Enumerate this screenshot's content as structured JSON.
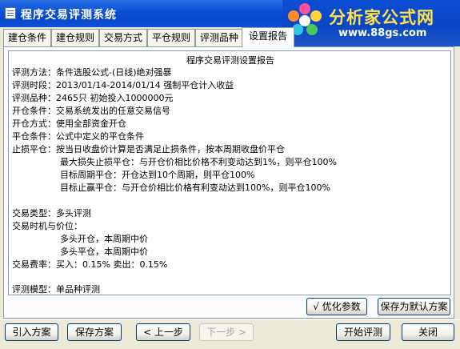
{
  "window": {
    "title": "程序交易评测系统"
  },
  "brand": {
    "name": "分析家公式网",
    "url": "www.88gs.com"
  },
  "tabs": [
    {
      "label": "建仓条件",
      "active": false
    },
    {
      "label": "建仓规则",
      "active": false
    },
    {
      "label": "交易方式",
      "active": false
    },
    {
      "label": "平仓规则",
      "active": false
    },
    {
      "label": "评测品种",
      "active": false
    },
    {
      "label": "设置报告",
      "active": true
    }
  ],
  "report": {
    "title": "程序交易评测设置报告",
    "lines": [
      "评测方法：条件选股公式-(日线)绝对强暴",
      "评测时段：2013/01/14-2014/01/14 强制平仓计入收益",
      "评测品种：2465只 初始投入1000000元",
      "开仓条件：交易系统发出的任意交易信号",
      "开仓方式：使用全部资金开仓",
      "平仓条件：公式中定义的平仓条件",
      "止损平仓：按当日收盘价计算是否满足止损条件，按本周期收盘价平仓",
      "最大损失止损平仓：与开仓价相比价格不利变动达到1%，则平仓100%",
      "目标周期平仓：开仓达到10个周期，则平仓100%",
      "目标止赢平仓：与开仓价相比价格有利变动达到100%，则平仓100%",
      "交易类型：多头评测",
      "交易时机与价位：",
      "多头开仓，本周期中价",
      "多头平仓，本周期中价",
      "交易费率：买入：0.15%    卖出：0.15%",
      "评测模型：单品种评测"
    ]
  },
  "panel_buttons": {
    "optimize": "√ 优化参数",
    "save_default": "保存为默认方案"
  },
  "footer_buttons": {
    "import": "引入方案",
    "save": "保存方案",
    "prev": "< 上一步",
    "next": "下一步 >",
    "start": "开始评测",
    "close": "关闭"
  }
}
